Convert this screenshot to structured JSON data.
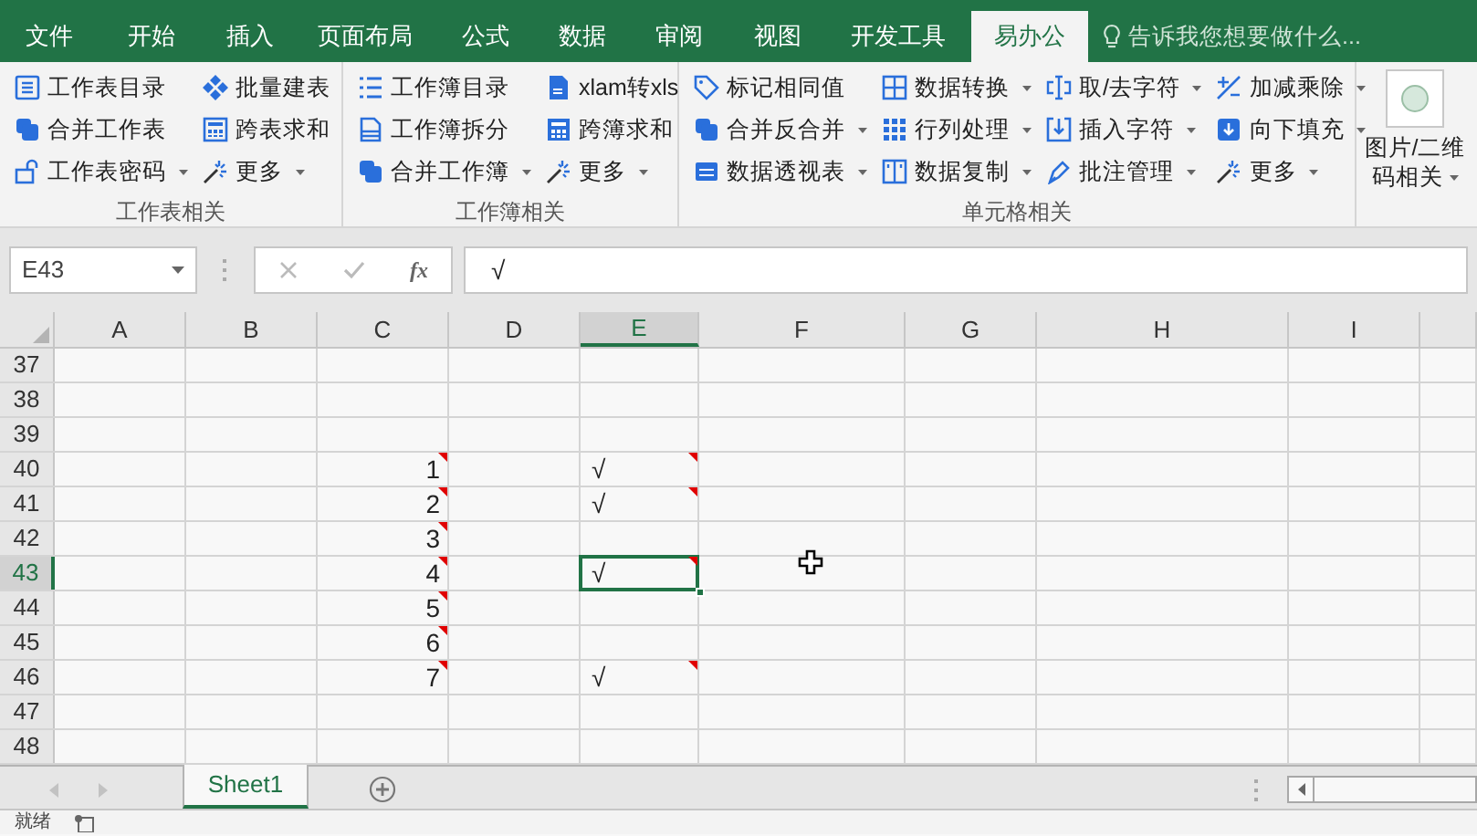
{
  "tabs": [
    {
      "label": "文件",
      "selected": false
    },
    {
      "label": "开始",
      "selected": false
    },
    {
      "label": "插入",
      "selected": false
    },
    {
      "label": "页面布局",
      "selected": false
    },
    {
      "label": "公式",
      "selected": false
    },
    {
      "label": "数据",
      "selected": false
    },
    {
      "label": "审阅",
      "selected": false
    },
    {
      "label": "视图",
      "selected": false
    },
    {
      "label": "开发工具",
      "selected": false
    },
    {
      "label": "易办公",
      "selected": true
    }
  ],
  "tell_me": {
    "placeholder": "告诉我您想要做什么..."
  },
  "ribbon_groups": [
    {
      "label": "工作表相关",
      "columns": [
        [
          {
            "label": "工作表目录",
            "dropdown": false
          },
          {
            "label": "合并工作表",
            "dropdown": false
          },
          {
            "label": "工作表密码",
            "dropdown": true
          }
        ],
        [
          {
            "label": "批量建表",
            "dropdown": false
          },
          {
            "label": "跨表求和",
            "dropdown": false
          },
          {
            "label": "更多",
            "dropdown": true
          }
        ]
      ]
    },
    {
      "label": "工作簿相关",
      "columns": [
        [
          {
            "label": "工作簿目录",
            "dropdown": false
          },
          {
            "label": "工作簿拆分",
            "dropdown": false
          },
          {
            "label": "合并工作簿",
            "dropdown": true
          }
        ],
        [
          {
            "label": "xlam转xls",
            "dropdown": false
          },
          {
            "label": "跨簿求和",
            "dropdown": false
          },
          {
            "label": "更多",
            "dropdown": true
          }
        ]
      ]
    },
    {
      "label": "单元格相关",
      "columns": [
        [
          {
            "label": "标记相同值",
            "dropdown": false
          },
          {
            "label": "合并反合并",
            "dropdown": true
          },
          {
            "label": "数据透视表",
            "dropdown": true
          }
        ],
        [
          {
            "label": "数据转换",
            "dropdown": true
          },
          {
            "label": "行列处理",
            "dropdown": true
          },
          {
            "label": "数据复制",
            "dropdown": true
          }
        ],
        [
          {
            "label": "取/去字符",
            "dropdown": true
          },
          {
            "label": "插入字符",
            "dropdown": true
          },
          {
            "label": "批注管理",
            "dropdown": true
          }
        ],
        [
          {
            "label": "加减乘除",
            "dropdown": true
          },
          {
            "label": "向下填充",
            "dropdown": true
          },
          {
            "label": "更多",
            "dropdown": true
          }
        ]
      ]
    }
  ],
  "large_button": {
    "label": "图片/二维码相关",
    "dropdown": true
  },
  "name_box": {
    "value": "E43"
  },
  "formula_bar": {
    "value": "√"
  },
  "insert_function": {
    "label": "fx"
  },
  "columns": [
    {
      "label": "A",
      "selected": false
    },
    {
      "label": "B",
      "selected": false
    },
    {
      "label": "C",
      "selected": false
    },
    {
      "label": "D",
      "selected": false
    },
    {
      "label": "E",
      "selected": true
    },
    {
      "label": "F",
      "selected": false
    },
    {
      "label": "G",
      "selected": false
    },
    {
      "label": "H",
      "selected": false
    },
    {
      "label": "I",
      "selected": false
    }
  ],
  "rows": [
    {
      "header": "37",
      "selected": false
    },
    {
      "header": "38",
      "selected": false
    },
    {
      "header": "39",
      "selected": false
    },
    {
      "header": "40",
      "selected": false,
      "c": {
        "text": "1",
        "comment": true,
        "selected": false
      },
      "e": {
        "text": "√",
        "comment": true,
        "selected": false
      }
    },
    {
      "header": "41",
      "selected": false,
      "c": {
        "text": "2",
        "comment": true,
        "selected": false
      },
      "e": {
        "text": "√",
        "comment": true,
        "selected": false
      }
    },
    {
      "header": "42",
      "selected": false,
      "c": {
        "text": "3",
        "comment": true,
        "selected": false
      }
    },
    {
      "header": "43",
      "selected": true,
      "c": {
        "text": "4",
        "comment": true,
        "selected": false
      },
      "e": {
        "text": "√",
        "comment": true,
        "selected": true
      }
    },
    {
      "header": "44",
      "selected": false,
      "c": {
        "text": "5",
        "comment": true,
        "selected": false
      }
    },
    {
      "header": "45",
      "selected": false,
      "c": {
        "text": "6",
        "comment": true,
        "selected": false
      }
    },
    {
      "header": "46",
      "selected": false,
      "c": {
        "text": "7",
        "comment": true,
        "selected": false
      },
      "e": {
        "text": "√",
        "comment": true,
        "selected": false
      }
    },
    {
      "header": "47",
      "selected": false
    },
    {
      "header": "48",
      "selected": false
    }
  ],
  "sheet_tabs": [
    {
      "label": "Sheet1",
      "selected": true
    }
  ],
  "status_bar": {
    "text": "就绪"
  }
}
